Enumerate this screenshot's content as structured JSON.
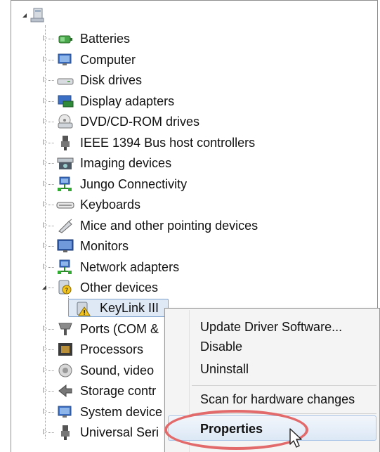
{
  "tree": {
    "items": [
      {
        "label": "Batteries",
        "icon": "battery-icon"
      },
      {
        "label": "Computer",
        "icon": "computer-icon"
      },
      {
        "label": "Disk drives",
        "icon": "disk-drive-icon"
      },
      {
        "label": "Display adapters",
        "icon": "display-adapter-icon"
      },
      {
        "label": "DVD/CD-ROM drives",
        "icon": "dvd-drive-icon"
      },
      {
        "label": "IEEE 1394 Bus host controllers",
        "icon": "ieee1394-icon"
      },
      {
        "label": "Imaging devices",
        "icon": "camera-icon"
      },
      {
        "label": "Jungo Connectivity",
        "icon": "network-icon"
      },
      {
        "label": "Keyboards",
        "icon": "keyboard-icon"
      },
      {
        "label": "Mice and other pointing devices",
        "icon": "mouse-icon"
      },
      {
        "label": "Monitors",
        "icon": "monitor-icon"
      },
      {
        "label": "Network adapters",
        "icon": "network-adapter-icon"
      },
      {
        "label": "Other devices",
        "icon": "unknown-device-icon"
      },
      {
        "label": "Ports (COM &",
        "icon": "port-icon"
      },
      {
        "label": "Processors",
        "icon": "processor-icon"
      },
      {
        "label": "Sound, video",
        "icon": "speaker-icon"
      },
      {
        "label": "Storage contr",
        "icon": "storage-icon"
      },
      {
        "label": "System device",
        "icon": "system-device-icon"
      },
      {
        "label": "Universal Seri",
        "icon": "usb-icon"
      }
    ],
    "child": {
      "label": "KeyLink III",
      "icon": "warning-device-icon"
    }
  },
  "context_menu": {
    "items": [
      "Update Driver Software...",
      "Disable",
      "Uninstall",
      "Scan for hardware changes",
      "Properties"
    ]
  },
  "colors": {
    "highlight_ring": "#e36a6a",
    "selection": "#dfe9f5"
  }
}
